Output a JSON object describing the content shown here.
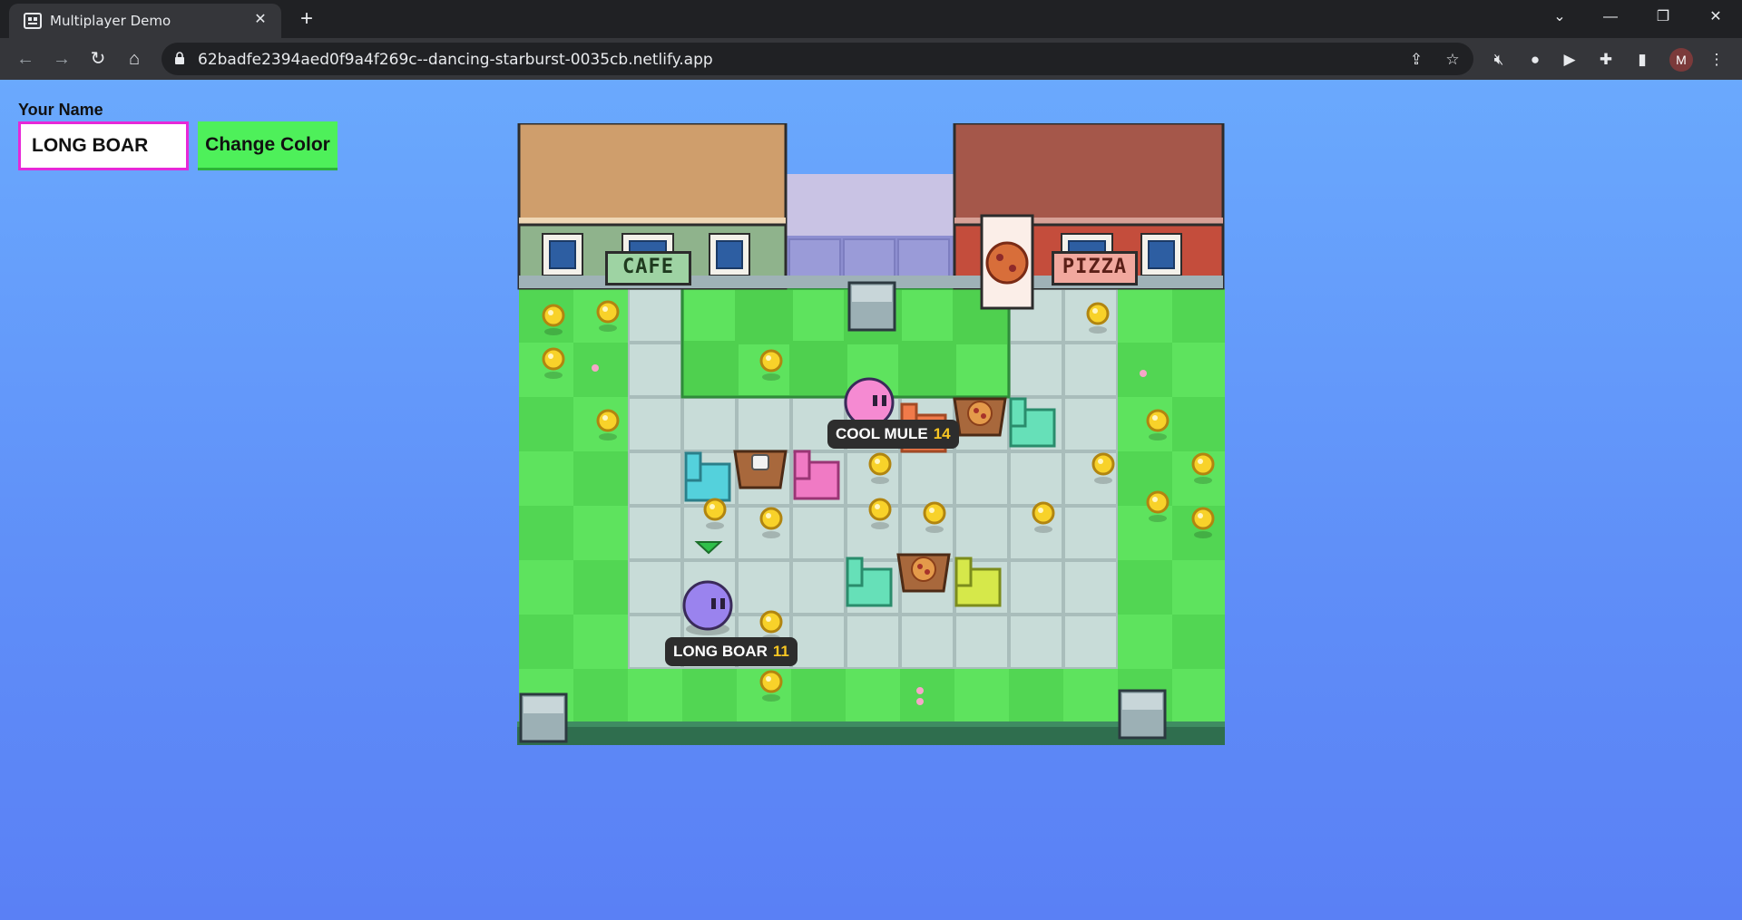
{
  "browser": {
    "tab_title": "Multiplayer Demo",
    "url": "62badfe2394aed0f9a4f269c--dancing-starburst-0035cb.netlify.app",
    "profile_initial": "M"
  },
  "form": {
    "name_label": "Your Name",
    "name_value": "LONG BOAR",
    "change_color_label": "Change Color"
  },
  "game": {
    "cafe_sign": "CAFE",
    "pizza_sign": "PIZZA",
    "players": [
      {
        "name": "COOL MULE",
        "score": "14",
        "color": "#f58ad2"
      },
      {
        "name": "LONG BOAR",
        "score": "11",
        "color": "#9a83ee"
      }
    ],
    "colors": {
      "grass": "#52d653",
      "floor": "#c8dcd8",
      "cafe_roof": "#cf9e6c",
      "pizza_roof": "#a5574a",
      "coin": "#f8d22a"
    }
  }
}
